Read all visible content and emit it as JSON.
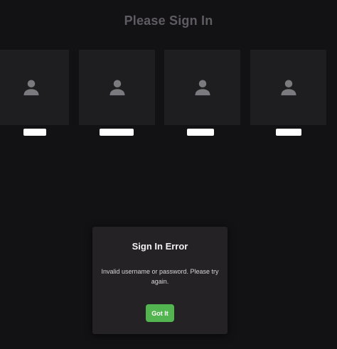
{
  "page": {
    "title": "Please Sign In",
    "background_color": "#121113",
    "title_color": "#5e5c62"
  },
  "users": [
    {
      "icon": "person-icon",
      "name_redacted": true
    },
    {
      "icon": "person-icon",
      "name_redacted": true
    },
    {
      "icon": "person-icon",
      "name_redacted": true
    },
    {
      "icon": "person-icon",
      "name_redacted": true
    }
  ],
  "dialog": {
    "title": "Sign In Error",
    "message": "Invalid username or password. Please try again.",
    "button_label": "Got It",
    "button_color": "#52b550"
  }
}
